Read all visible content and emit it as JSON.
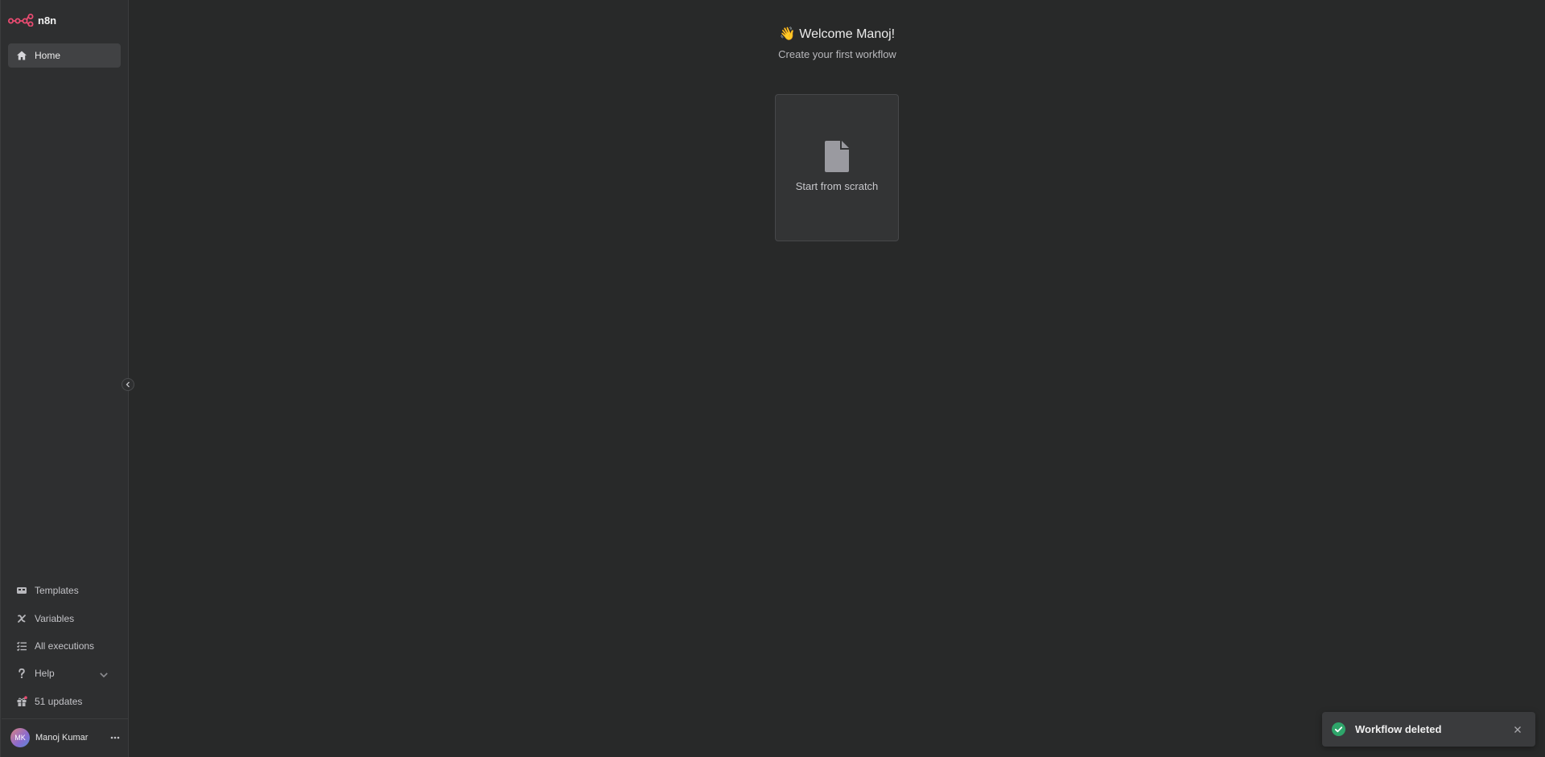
{
  "app": {
    "name": "n8n",
    "brand_color": "#ea4b71"
  },
  "sidebar": {
    "home_label": "Home",
    "items": [
      {
        "label": "Templates",
        "icon": "box-icon"
      },
      {
        "label": "Variables",
        "icon": "variable-icon"
      },
      {
        "label": "All executions",
        "icon": "tasks-icon"
      },
      {
        "label": "Help",
        "icon": "question-icon"
      },
      {
        "label": "51 updates",
        "icon": "gift-icon"
      }
    ],
    "user": {
      "initials": "MK",
      "name": "Manoj Kumar"
    }
  },
  "main": {
    "welcome_emoji": "👋",
    "welcome": "Welcome Manoj!",
    "subtitle": "Create your first workflow",
    "card_label": "Start from scratch"
  },
  "toast": {
    "message": "Workflow deleted",
    "status_color": "#2ea56a"
  }
}
